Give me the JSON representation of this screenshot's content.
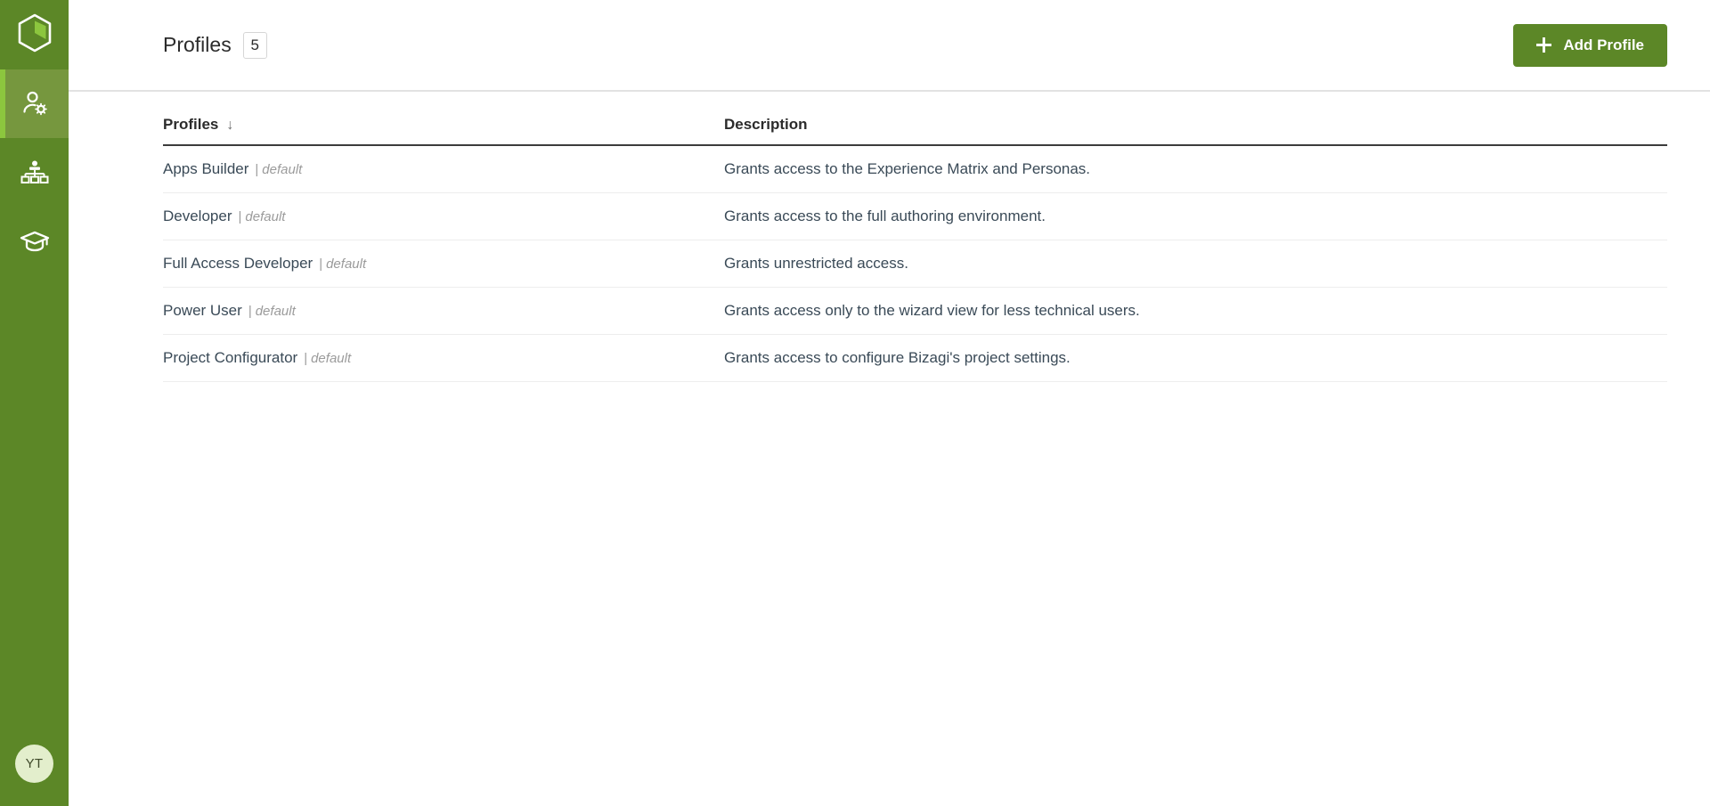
{
  "brand": {
    "accent_green": "#5c8727",
    "active_green": "#76973e",
    "indicator_green": "#8cc63e",
    "avatar_bg": "#e3eecc",
    "logo_name": "bizagi-hexagon-logo"
  },
  "sidebar": {
    "logo_label": "Bizagi",
    "items": [
      {
        "icon": "user-settings-icon",
        "label": "Profiles",
        "active": true
      },
      {
        "icon": "org-chart-icon",
        "label": "Organization",
        "active": false
      },
      {
        "icon": "graduation-cap-icon",
        "label": "Learning",
        "active": false
      }
    ],
    "avatar": {
      "initials": "YT",
      "label": "User account"
    }
  },
  "header": {
    "title": "Profiles",
    "count": "5",
    "add_button": {
      "label": "Add Profile",
      "icon": "plus-icon"
    }
  },
  "table": {
    "columns": [
      {
        "label": "Profiles",
        "sort_icon": "arrow-down-icon",
        "sorted": true
      },
      {
        "label": "Description",
        "sort_icon": "",
        "sorted": false
      }
    ],
    "rows": [
      {
        "name": "Apps Builder",
        "tag": "default",
        "description": "Grants access to the Experience Matrix and Personas."
      },
      {
        "name": "Developer",
        "tag": "default",
        "description": "Grants access to the full authoring environment."
      },
      {
        "name": "Full Access Developer",
        "tag": "default",
        "description": "Grants unrestricted access."
      },
      {
        "name": "Power User",
        "tag": "default",
        "description": "Grants access only to the wizard view for less technical users."
      },
      {
        "name": "Project Configurator",
        "tag": "default",
        "description": "Grants access to configure Bizagi's project settings."
      }
    ]
  }
}
